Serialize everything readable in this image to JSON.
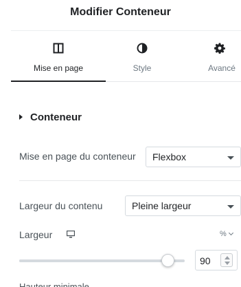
{
  "header": {
    "title": "Modifier Conteneur"
  },
  "tabs": [
    {
      "label": "Mise en page",
      "icon": "columns-icon",
      "active": true
    },
    {
      "label": "Style",
      "icon": "half-circle-icon",
      "active": false
    },
    {
      "label": "Avancé",
      "icon": "gear-icon",
      "active": false
    }
  ],
  "section": {
    "title": "Conteneur",
    "expanded": true
  },
  "layout_row": {
    "label": "Mise en page du conteneur",
    "value": "Flexbox"
  },
  "content_width_row": {
    "label": "Largeur du contenu",
    "value": "Pleine largeur"
  },
  "width_row": {
    "label": "Largeur",
    "device_icon": "monitor-icon",
    "unit": "%",
    "value": "90",
    "slider_fraction": 0.9
  },
  "next_row": {
    "label_partial": "Hauteur minimale"
  },
  "colors": {
    "accent": "#1f2124",
    "muted": "#6d7882",
    "border": "#d5dadf"
  }
}
